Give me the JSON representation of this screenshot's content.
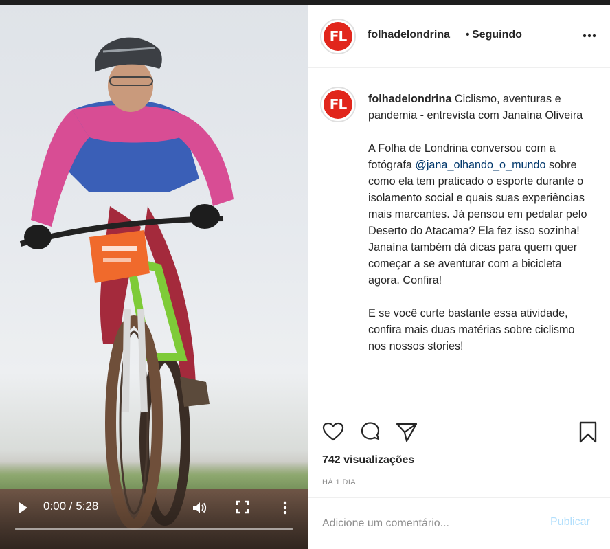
{
  "video": {
    "time": "0:00 / 5:28",
    "progress": 0.0
  },
  "post": {
    "avatar_text": "FL",
    "username": "folhadelondrina",
    "separator": "•",
    "following_label": "Seguindo",
    "caption": {
      "username": "folhadelondrina",
      "headline": "Ciclismo, aventuras e pandemia - entrevista com Janaína Oliveira",
      "p2_before": "A Folha de Londrina conversou com a fotógrafa ",
      "mention": "@jana_olhando_o_mundo",
      "p2_after": " sobre como ela tem praticado o esporte durante o isolamento social e quais suas experiências mais marcantes. Já pensou em pedalar pelo Deserto do Atacama? Ela fez isso sozinha! Janaína também dá dicas para quem quer começar a se aventurar com a bicicleta agora. Confira!",
      "p3": "E se você curte bastante essa atividade, confira mais duas matérias sobre ciclismo nos nossos stories!"
    },
    "views": "742 visualizações",
    "time_ago": "HÁ 1 DIA"
  },
  "comment": {
    "placeholder": "Adicione um comentário...",
    "post_label": "Publicar"
  },
  "colors": {
    "brand_red": "#e1261c",
    "link": "#00376b",
    "publish_disabled": "#b2dffc",
    "muted": "#8e8e8e"
  },
  "icons": {
    "play": "play-icon",
    "volume": "volume-icon",
    "fullscreen": "fullscreen-icon",
    "video_more": "kebab-icon",
    "post_more": "ellipsis-icon",
    "like": "heart-icon",
    "comment": "comment-icon",
    "share": "paper-plane-icon",
    "save": "bookmark-icon"
  }
}
